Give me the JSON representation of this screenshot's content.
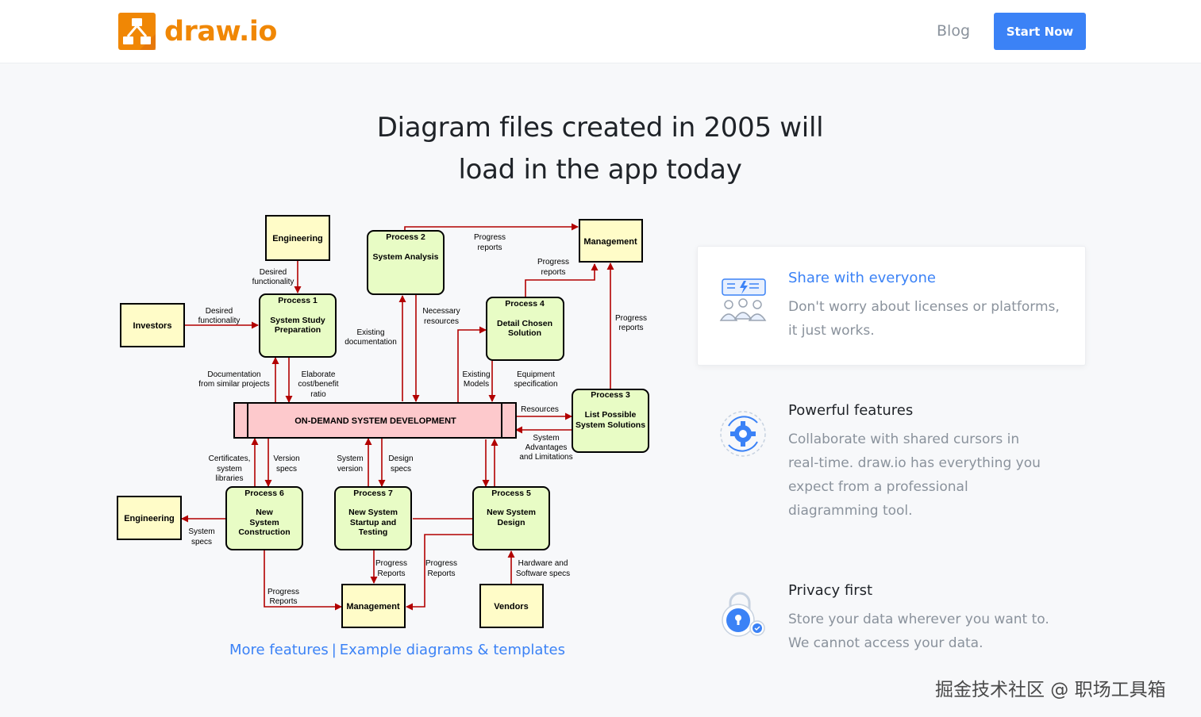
{
  "header": {
    "logo_text": "draw.io",
    "blog_label": "Blog",
    "start_label": "Start Now"
  },
  "hero": {
    "line1": "Diagram files created in 2005 will",
    "line2": "load in the app today"
  },
  "diagram": {
    "nodes": {
      "engineering_top": "Engineering",
      "investors": "Investors",
      "process1_head": "Process 1",
      "process1_body": [
        "System Study",
        "Preparation"
      ],
      "process2_head": "Process 2",
      "process2_body": "System Analysis",
      "management_top": "Management",
      "process4_head": "Process 4",
      "process4_body": [
        "Detail Chosen",
        "Solution"
      ],
      "process3_head": "Process 3",
      "process3_body": [
        "List Possible",
        "System Solutions"
      ],
      "center": "ON-DEMAND SYSTEM DEVELOPMENT",
      "engineering_left": "Engineering",
      "process6_head": "Process 6",
      "process6_body": [
        "New",
        "System",
        "Construction"
      ],
      "process7_head": "Process 7",
      "process7_body": [
        "New System",
        "Startup and",
        "Testing"
      ],
      "process5_head": "Process 5",
      "process5_body": [
        "New System",
        "Design"
      ],
      "management_bottom": "Management",
      "vendors": "Vendors"
    },
    "edges": {
      "desired_functionality_top": [
        "Desired",
        "functionality"
      ],
      "desired_functionality_left": [
        "Desired",
        "functionality"
      ],
      "progress_reports_top": [
        "Progress",
        "reports"
      ],
      "progress_reports_mid": [
        "Progress",
        "reports"
      ],
      "progress_reports_right": [
        "Progress",
        "reports"
      ],
      "existing_documentation": [
        "Existing",
        "documentation"
      ],
      "necessary_resources": [
        "Necessary",
        "resources"
      ],
      "documentation_similar": [
        "Documentation",
        "from similar projects"
      ],
      "elaborate": [
        "Elaborate",
        "cost/benefit",
        "ratio"
      ],
      "existing_models": [
        "Existing",
        "Models"
      ],
      "equipment_spec": [
        "Equipment",
        "specification"
      ],
      "resources": "Resources",
      "system_advantages": [
        "System",
        "Advantages",
        "and Limitations"
      ],
      "certificates": [
        "Certificates,",
        "system",
        "libraries"
      ],
      "version_specs": [
        "Version",
        "specs"
      ],
      "system_version": [
        "System",
        "version"
      ],
      "design_specs": [
        "Design",
        "specs"
      ],
      "system_specs": [
        "System",
        "specs"
      ],
      "progress_reports_p7": [
        "Progress",
        "Reports"
      ],
      "progress_reports_p5": [
        "Progress",
        "Reports"
      ],
      "progress_reports_p6": [
        "Progress",
        "Reports"
      ],
      "hardware_software": [
        "Hardware and",
        "Software specs"
      ]
    }
  },
  "links": {
    "more_features": "More features",
    "separator": "|",
    "examples": "Example diagrams & templates"
  },
  "features": [
    {
      "title": "Share with everyone",
      "icon": "share-people-icon",
      "lines": [
        "Don't worry about licenses or platforms,",
        "it just works."
      ]
    },
    {
      "title": "Powerful features",
      "icon": "gear-sync-icon",
      "lines": [
        "Collaborate with shared cursors in",
        "real-time. draw.io has everything you",
        "expect from a professional",
        "diagramming tool."
      ]
    },
    {
      "title": "Privacy first",
      "icon": "lock-shield-icon",
      "lines": [
        "Store your data wherever you want to.",
        "We cannot access your data."
      ]
    }
  ],
  "watermark": "掘金技术社区 @ 职场工具箱",
  "colors": {
    "brand_orange": "#f08705",
    "accent_blue": "#3b82f6",
    "arrow_red": "#b20000",
    "process_fill": "#e8fcc5",
    "entity_fill": "#fffcc8",
    "center_fill": "#fdc9cc"
  }
}
